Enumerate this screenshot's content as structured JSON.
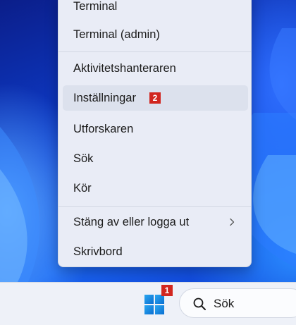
{
  "menu": {
    "items": [
      {
        "label": "Terminal"
      },
      {
        "label": "Terminal (admin)"
      },
      {
        "label": "Aktivitetshanteraren"
      },
      {
        "label": "Inställningar",
        "badge": "2"
      },
      {
        "label": "Utforskaren"
      },
      {
        "label": "Sök"
      },
      {
        "label": "Kör"
      },
      {
        "label": "Stäng av eller logga ut",
        "icon": "chevron-right-icon"
      },
      {
        "label": "Skrivbord"
      }
    ]
  },
  "taskbar": {
    "start_icon": "windows-logo-icon",
    "start_badge": "1",
    "search": {
      "icon": "search-icon",
      "label": "Sök"
    }
  },
  "colors": {
    "badge": "#d1261f",
    "windows_logo": "#1a8fe0",
    "menu_bg": "#e9ecf6",
    "taskbar_bg": "#eef1f8"
  }
}
